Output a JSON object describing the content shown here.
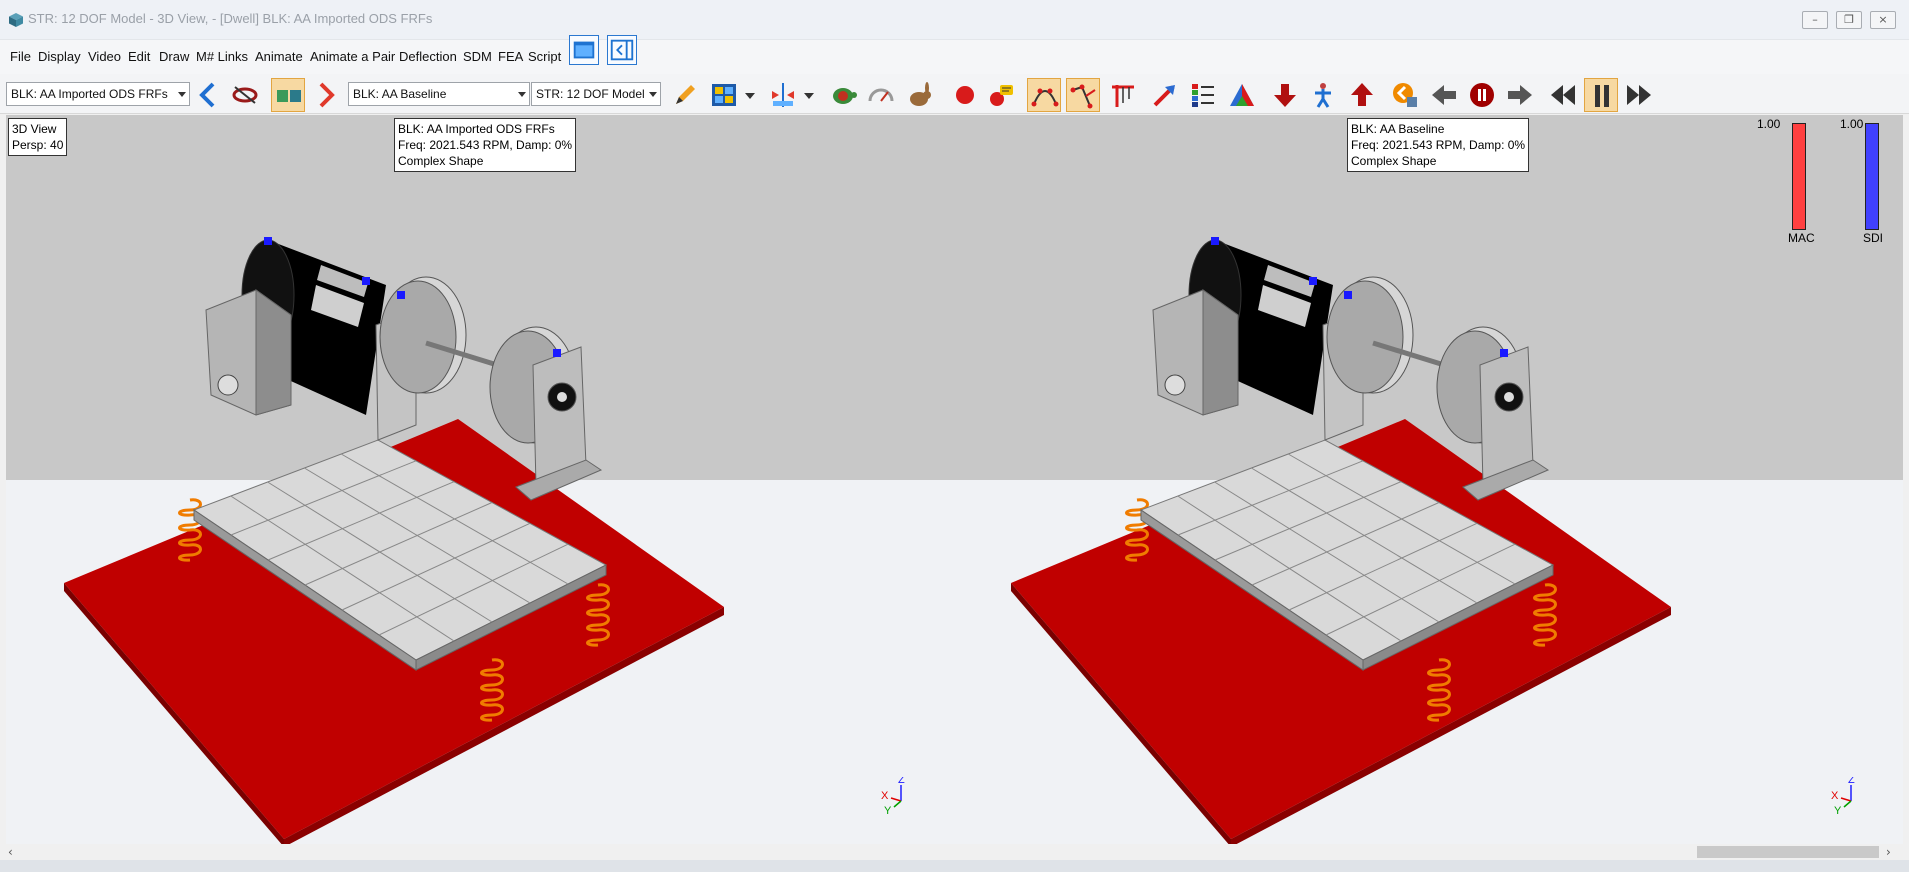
{
  "window": {
    "title": "STR: 12 DOF Model - 3D View,  - [Dwell] BLK: AA Imported ODS FRFs",
    "minimize_symbol": "–",
    "maximize_symbol": "❐",
    "close_symbol": "×"
  },
  "menu": {
    "items": [
      "File",
      "Display",
      "Video",
      "Edit",
      "Draw",
      "M# Links",
      "Animate",
      "Animate a Pair",
      "Deflection",
      "SDM",
      "FEA",
      "Script"
    ]
  },
  "toolbar": {
    "block_select": "BLK: AA Imported ODS FRFs",
    "baseline_select": "BLK: AA Baseline",
    "structure_select": "STR: 12 DOF Model",
    "icons": [
      "prev-arrow-icon",
      "scissors-icon",
      "dual-view-icon",
      "next-arrow-icon",
      "pencil-icon",
      "color-grid-icon",
      "split-icon",
      "turtle-icon",
      "speedometer-icon",
      "rabbit-icon",
      "record-icon",
      "annotate-icon",
      "shape-points-icon",
      "shape-edit-icon",
      "crane-icon",
      "arrow-icon",
      "legend-icon",
      "prism-icon",
      "down-arrow-icon",
      "figure-icon",
      "up-arrow-icon",
      "back-orange-icon",
      "left-arrow-icon",
      "pause-circle-icon",
      "right-arrow-icon",
      "rewind-icon",
      "pause-bars-icon",
      "fast-forward-icon"
    ]
  },
  "views": {
    "left": {
      "view_info": {
        "line1": "3D View",
        "line2": "Persp: 40"
      },
      "shape_info": {
        "line1": "BLK: AA Imported ODS FRFs",
        "line2": "Freq: 2021.543 RPM, Damp: 0%",
        "line3": "Complex Shape"
      }
    },
    "right": {
      "shape_info": {
        "line1": "BLK: AA Baseline",
        "line2": "Freq: 2021.543 RPM, Damp: 0%",
        "line3": "Complex Shape"
      }
    },
    "axes": {
      "z": "Z",
      "x": "X",
      "y": "Y"
    }
  },
  "indicators": {
    "mac": {
      "label": "MAC",
      "value_label": "1.00",
      "value": 1.0,
      "color": "#ff4040"
    },
    "sdi": {
      "label": "SDI",
      "value_label": "1.00",
      "value": 1.0,
      "color": "#4040ff"
    }
  },
  "colors": {
    "floor": "#c00000",
    "spring": "#f07c00",
    "marker": "#1a1aff",
    "motor": "#000000"
  }
}
